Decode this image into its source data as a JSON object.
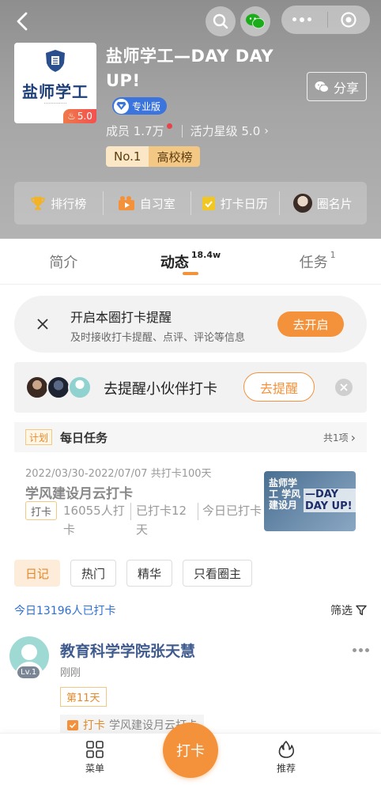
{
  "header": {
    "title": "盐师学工—DAY DAY UP!",
    "pro_label": "专业版",
    "share_label": "分享",
    "members": "成员 1.7万",
    "vitality": "活力星级 5.0",
    "rank_no": "No.1",
    "rank_label": "高校榜",
    "logo_text": "盐师学工",
    "logo_rating": "5.0"
  },
  "quick_links": [
    {
      "label": "排行榜",
      "icon": "trophy-icon"
    },
    {
      "label": "自习室",
      "icon": "study-room-icon"
    },
    {
      "label": "打卡日历",
      "icon": "calendar-icon"
    },
    {
      "label": "圈名片",
      "icon": "avatar-card-icon"
    }
  ],
  "tabs": [
    {
      "label": "简介",
      "badge": ""
    },
    {
      "label": "动态",
      "badge": "18.4w"
    },
    {
      "label": "任务",
      "badge": "1"
    }
  ],
  "remind": {
    "title": "开启本圈打卡提醒",
    "desc": "及时接收打卡提醒、点评、评论等信息",
    "button": "去开启"
  },
  "partner": {
    "text": "去提醒小伙伴打卡",
    "button": "去提醒"
  },
  "daily": {
    "tag": "计划",
    "title": "每日任务",
    "count": "共1项"
  },
  "task": {
    "dates": "2022/03/30-2022/07/07",
    "total": "共打卡100天",
    "name": "学风建设月云打卡",
    "chip": "打卡",
    "meta1": "16055人打卡",
    "meta2": "已打卡12天",
    "meta3": "今日已打卡",
    "thumb_a": "盐师学工 学风 建设月",
    "thumb_b": "—DAY DAY UP!"
  },
  "filters": [
    "日记",
    "热门",
    "精华",
    "只看圈主"
  ],
  "today": "今日13196人已打卡",
  "filter_label": "筛选",
  "post": {
    "level": "Lv.1",
    "name": "教育科学学院张天慧",
    "time": "刚刚",
    "day": "第11天",
    "checkin": "打卡",
    "checkin_name": "学风建设月云打卡"
  },
  "bottom": {
    "menu": "菜单",
    "cta": "打卡",
    "recommend": "推荐"
  },
  "colors": {
    "accent": "#f3923b",
    "blue": "#2d6fd2",
    "pro": "#3c74dd",
    "wechat": "#1aad19"
  }
}
